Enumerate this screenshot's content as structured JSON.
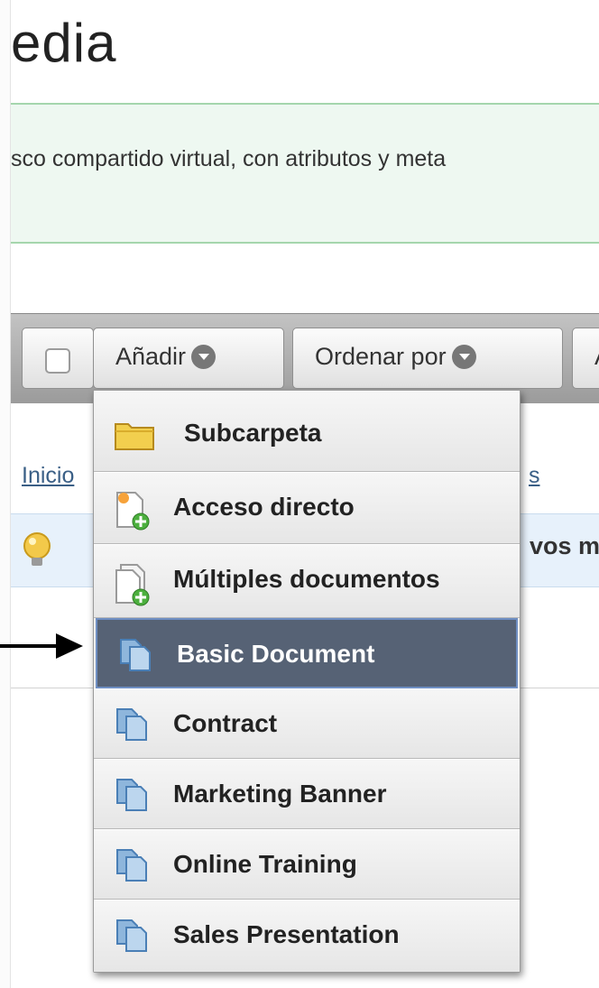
{
  "page": {
    "title_partial": "edia",
    "description_partial": "sco compartido virtual, con atributos y meta"
  },
  "toolbar": {
    "add_label": "Añadir",
    "sort_label": "Ordenar por",
    "more_partial": "A"
  },
  "breadcrumb": {
    "start": "Inicio",
    "end_partial": "s"
  },
  "hint": {
    "start_partial": "",
    "end_partial": "vos m"
  },
  "add_menu": {
    "items": [
      {
        "label": "Subcarpeta",
        "icon": "folder-icon"
      },
      {
        "label": "Acceso directo",
        "icon": "shortcut-icon"
      },
      {
        "label": "Múltiples documentos",
        "icon": "multiple-documents-icon"
      },
      {
        "label": "Basic Document",
        "icon": "document-type-icon",
        "selected": true
      },
      {
        "label": "Contract",
        "icon": "document-type-icon"
      },
      {
        "label": "Marketing Banner",
        "icon": "document-type-icon"
      },
      {
        "label": "Online Training",
        "icon": "document-type-icon"
      },
      {
        "label": "Sales Presentation",
        "icon": "document-type-icon"
      }
    ]
  },
  "colors": {
    "selected_bg": "#566275",
    "toolbar_bg": "#a8a8a8",
    "link": "#3a5f86",
    "desc_bg": "#eef8f1"
  }
}
